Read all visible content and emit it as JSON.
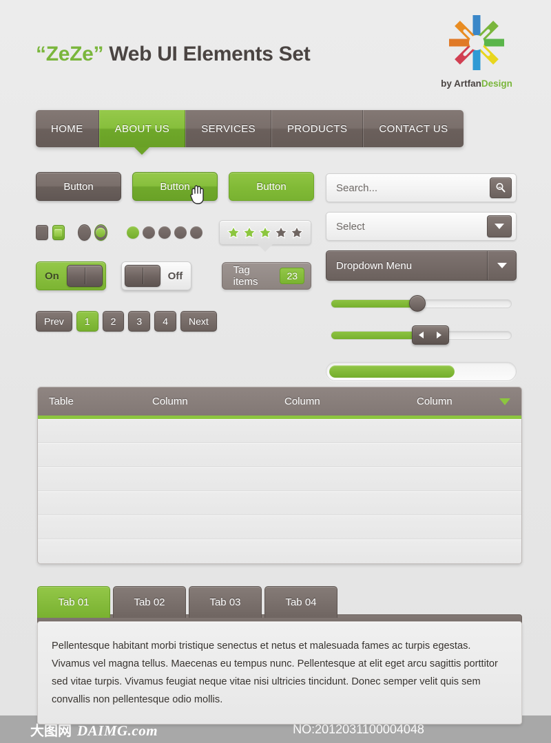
{
  "header": {
    "title_accent": "“ZeZe”",
    "title_rest": " Web UI Elements Set",
    "brand_prefix": "by Artfan",
    "brand_accent": "Design",
    "logo_icon": "starburst-logo"
  },
  "nav": {
    "items": [
      {
        "label": "HOME",
        "active": false
      },
      {
        "label": "ABOUT US",
        "active": true
      },
      {
        "label": "SERVICES",
        "active": false
      },
      {
        "label": "PRODUCTS",
        "active": false
      },
      {
        "label": "CONTACT US",
        "active": false
      }
    ]
  },
  "buttons": [
    {
      "label": "Button",
      "style": "gray"
    },
    {
      "label": "Button",
      "style": "green-hover"
    },
    {
      "label": "Button",
      "style": "green"
    }
  ],
  "controls": {
    "checkbox_unchecked": "",
    "checkbox_checked": "",
    "radio_unchecked": "",
    "radio_checked": "",
    "dots_total": 5,
    "dots_active_index": 0,
    "rating": {
      "total": 5,
      "filled": 3,
      "star_icon": "star-icon"
    }
  },
  "toggles": [
    {
      "label": "On",
      "state": "on"
    },
    {
      "label": "Off",
      "state": "off"
    }
  ],
  "tag": {
    "label": "Tag items",
    "count": "23"
  },
  "pagination": {
    "prev_label": "Prev",
    "next_label": "Next",
    "pages": [
      "1",
      "2",
      "3",
      "4"
    ],
    "active_page": "1"
  },
  "form": {
    "search_placeholder": "Search...",
    "search_icon": "search-icon",
    "select_value": "Select",
    "select_icon": "caret-down-icon",
    "dropdown_value": "Dropdown Menu",
    "dropdown_icon": "caret-down-icon"
  },
  "sliders": [
    {
      "name": "round-handle-slider",
      "value": 48,
      "handle": "round"
    },
    {
      "name": "arrows-handle-slider",
      "value": 55,
      "handle": "arrows"
    },
    {
      "name": "progress-bar",
      "value": 68,
      "handle": "none"
    }
  ],
  "table": {
    "headers": [
      "Table",
      "Column",
      "Column",
      "Column"
    ],
    "sort_icon": "sort-descending-icon",
    "rows": [
      [],
      [],
      [],
      [],
      [],
      []
    ]
  },
  "tabs": {
    "items": [
      {
        "label": "Tab 01",
        "active": true
      },
      {
        "label": "Tab 02",
        "active": false
      },
      {
        "label": "Tab 03",
        "active": false
      },
      {
        "label": "Tab 04",
        "active": false
      }
    ],
    "panel_text": "Pellentesque habitant morbi tristique senectus et netus et malesuada fames ac turpis egestas. Vivamus vel magna tellus. Maecenas eu tempus nunc. Pellentesque at elit eget arcu sagittis porttitor sed vitae turpis. Vivamus feugiat neque vitae nisi ultricies tincidunt. Donec semper velit quis sem convallis non pellentesque odio mollis."
  },
  "footer": {
    "site_cn": "大图网",
    "site_en": "DAIMG.com",
    "number": "NO:2012031100004048"
  },
  "colors": {
    "green": "#8cc63f",
    "green_dark": "#6aa227",
    "gray_dark": "#6b615d",
    "background": "#e8e8e8",
    "footer_bar": "#a8a8a8"
  }
}
